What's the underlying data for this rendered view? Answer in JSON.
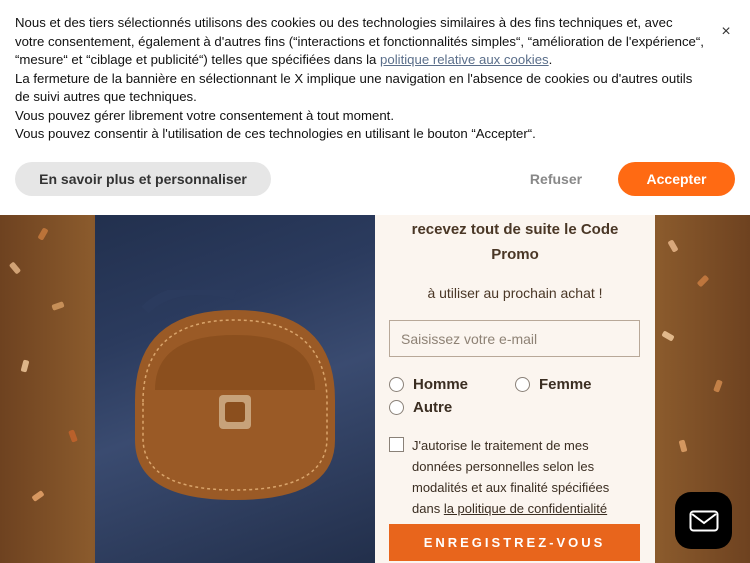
{
  "cookie_banner": {
    "lines": [
      "Nous et des tiers sélectionnés utilisons des cookies ou des technologies similaires à des fins techniques et, avec votre consentement, également à d'autres fins (“interactions et fonctionnalités simples“, “amélioration de l'expérience“, “mesure“ et “ciblage et publicité“) telles que spécifiées dans la ",
      "politique relative aux cookies",
      "."
    ],
    "line2": "La fermeture de la bannière en sélectionnant le X implique une navigation en l'absence de cookies ou d'autres outils de suivi autres que techniques.",
    "line3": "Vous pouvez gérer librement votre consentement à tout moment.",
    "line4": "Vous pouvez consentir à l'utilisation de ces technologies en utilisant le bouton “Accepter“.",
    "close_label": "×",
    "more_label": "En savoir plus et personnaliser",
    "refuse_label": "Refuser",
    "accept_label": "Accepter"
  },
  "popup": {
    "promo_line1": "recevez tout de suite le Code",
    "promo_line2": "Promo",
    "promo_sub": "à utiliser au prochain achat !",
    "email_placeholder": "Saisissez votre e-mail",
    "gender_options": [
      "Homme",
      "Femme",
      "Autre"
    ],
    "consent_text": "J'autorise le traitement de mes données personnelles selon les modalités et aux finalité spécifiées dans ",
    "consent_link": "la politique de confidentialité",
    "submit_label": "ENREGISTREZ-VOUS"
  },
  "colors": {
    "accent": "#ff6a13",
    "submit": "#e8651c"
  },
  "icons": {
    "close": "close-icon",
    "chat": "envelope-icon"
  }
}
